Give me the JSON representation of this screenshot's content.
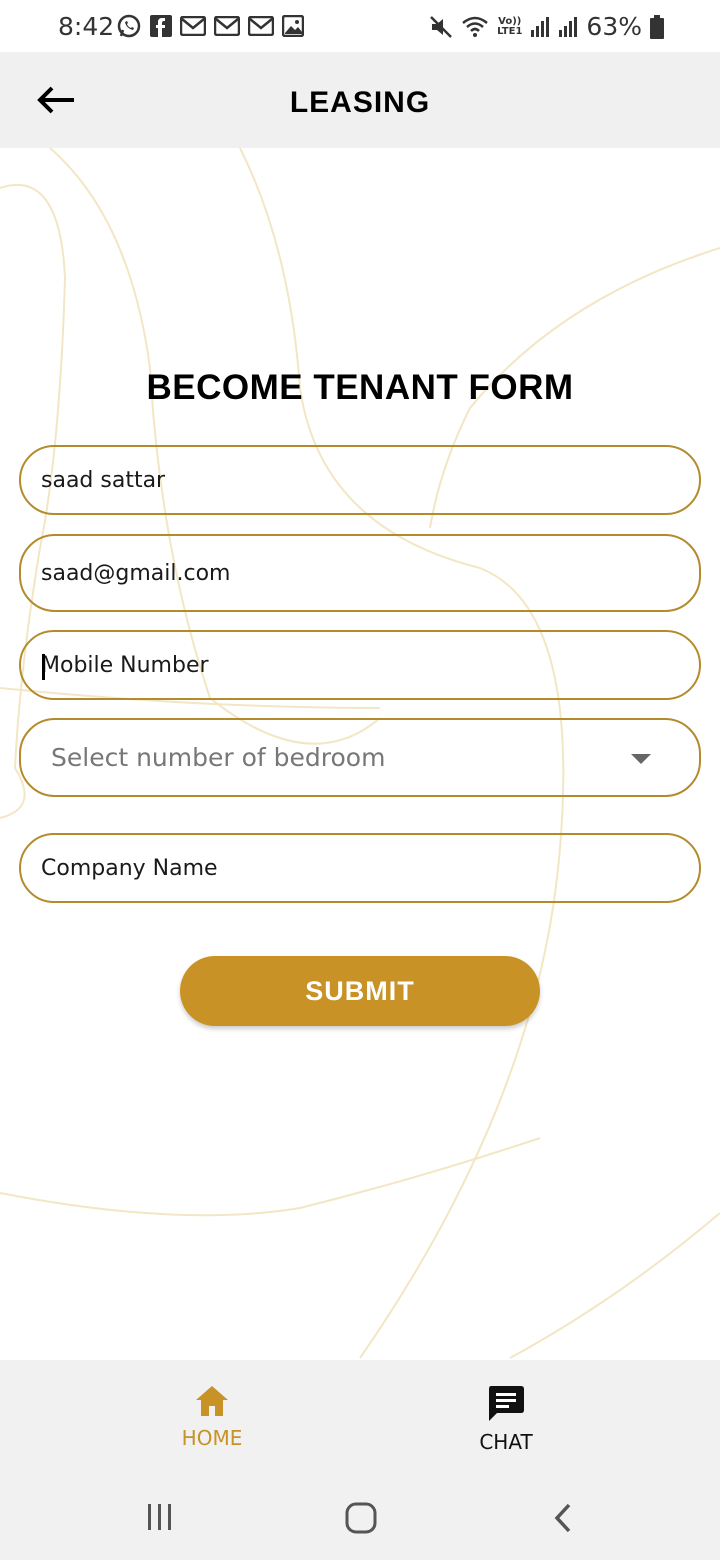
{
  "status_bar": {
    "time": "8:42",
    "battery": "63%",
    "network_label_top": "Vo))",
    "network_label_bottom": "LTE1",
    "left_icons": [
      "whatsapp-icon",
      "facebook-icon",
      "gmail-icon",
      "gmail-icon",
      "gmail-icon",
      "gallery-icon"
    ],
    "right_icons": [
      "mute-icon",
      "wifi-icon",
      "signal-icon",
      "signal-icon",
      "battery-icon"
    ]
  },
  "header": {
    "title": "LEASING",
    "back_icon": "arrow-left-icon"
  },
  "form": {
    "title": "BECOME TENANT FORM",
    "name_value": "saad sattar",
    "email_value": "saad@gmail.com",
    "mobile_placeholder": "Mobile Number",
    "bedroom_placeholder": "Select number of bedroom",
    "company_placeholder": "Company Name",
    "submit_label": "SUBMIT"
  },
  "bottom_nav": {
    "items": [
      {
        "label": "HOME",
        "icon": "home-icon",
        "active": true
      },
      {
        "label": "CHAT",
        "icon": "chat-icon",
        "active": false
      }
    ]
  },
  "colors": {
    "accent": "#c89226",
    "border": "#b38b2c",
    "header_bg": "#f0f0f0",
    "curve": "#f3e6c4"
  }
}
